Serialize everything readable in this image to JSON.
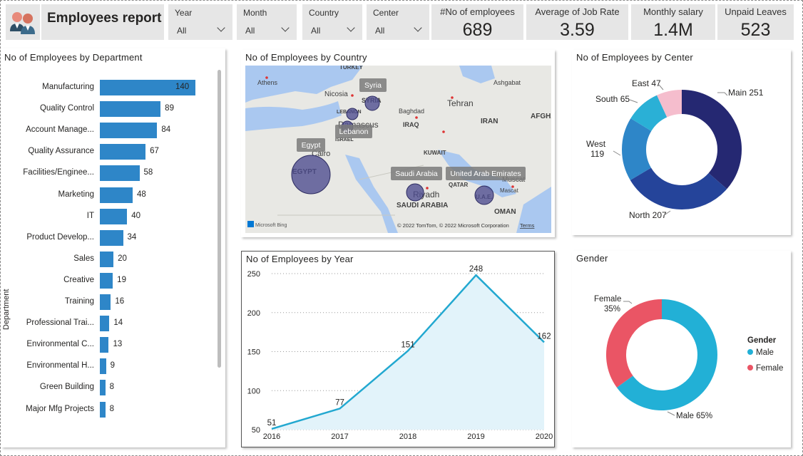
{
  "header": {
    "title": "Employees report",
    "slicers": [
      {
        "label": "Year",
        "value": "All"
      },
      {
        "label": "Month",
        "value": "All"
      },
      {
        "label": "Country",
        "value": "All"
      },
      {
        "label": "Center",
        "value": "All"
      }
    ],
    "kpis": [
      {
        "label": "#No of employees",
        "value": "689"
      },
      {
        "label": "Average of Job Rate",
        "value": "3.59"
      },
      {
        "label": "Monthly salary",
        "value": "1.4M"
      },
      {
        "label": "Unpaid Leaves",
        "value": "523"
      }
    ]
  },
  "department_card": {
    "title": "No of Employees by Department",
    "axis_label": "Department"
  },
  "country_card": {
    "title": "No of Employees by Country",
    "attribution": "© 2022 TomTom, © 2022 Microsoft Corporation",
    "terms": "Terms",
    "bing": "Microsoft Bing",
    "place_labels": [
      "TURKEY",
      "Athens",
      "Nicosia",
      "Ashgabat",
      "SYRIA",
      "LEBANON",
      "Damascus",
      "Baghdad",
      "IRAQ",
      "Tehran",
      "IRAN",
      "AFGHA",
      "ISRAEL",
      "Cairo",
      "EGYPT",
      "KUWAIT",
      "QATAR",
      "Riyadh",
      "SAUDI ARABIA",
      "U.A.E.",
      "Muscat",
      "Mascat",
      "OMAN"
    ],
    "bubble_labels": [
      "Syria",
      "Lebanon",
      "Egypt",
      "Saudi Arabia",
      "United Arab Emirates"
    ]
  },
  "center_card": {
    "title": "No of Employees by Center",
    "slice_labels": [
      "Main 251",
      "North 207",
      "West\n119",
      "South 65",
      "East 47"
    ]
  },
  "year_card": {
    "title": "No of Employees by Year"
  },
  "gender_card": {
    "title": "Gender",
    "legend_title": "Gender",
    "legend": [
      "Male",
      "Female"
    ],
    "slice_labels": [
      "Female\n35%",
      "Male 65%"
    ]
  },
  "colors": {
    "bar": "#2e86c8",
    "center_main": "#252872",
    "center_north": "#25449a",
    "center_west": "#2e86c8",
    "center_south": "#2ab0d6",
    "center_east": "#f5bdcd",
    "male": "#22b0d6",
    "female": "#ea5565",
    "line": "#22a8d0",
    "area": "#e2f3fa",
    "bubble": "#4b4a8e"
  },
  "chart_data": [
    {
      "type": "bar",
      "title": "No of Employees by Department",
      "ylabel": "Department",
      "categories": [
        "Manufacturing",
        "Quality Control",
        "Account Manage...",
        "Quality Assurance",
        "Facilities/Enginee...",
        "Marketing",
        "IT",
        "Product Develop...",
        "Sales",
        "Creative",
        "Training",
        "Professional Trai...",
        "Environmental C...",
        "Environmental H...",
        "Green Building",
        "Major Mfg Projects"
      ],
      "values": [
        140,
        89,
        84,
        67,
        58,
        48,
        40,
        34,
        20,
        19,
        16,
        14,
        13,
        9,
        8,
        8
      ]
    },
    {
      "type": "pie",
      "title": "No of Employees by Center",
      "categories": [
        "Main",
        "North",
        "West",
        "South",
        "East"
      ],
      "values": [
        251,
        207,
        119,
        65,
        47
      ]
    },
    {
      "type": "area",
      "title": "No of Employees by Year",
      "x": [
        "2016",
        "2017",
        "2018",
        "2019",
        "2020"
      ],
      "values": [
        51,
        77,
        151,
        248,
        162
      ],
      "yticks": [
        50,
        100,
        150,
        200,
        250
      ],
      "ylim": [
        50,
        250
      ]
    },
    {
      "type": "pie",
      "title": "Gender",
      "categories": [
        "Male",
        "Female"
      ],
      "values": [
        65,
        35
      ]
    }
  ]
}
